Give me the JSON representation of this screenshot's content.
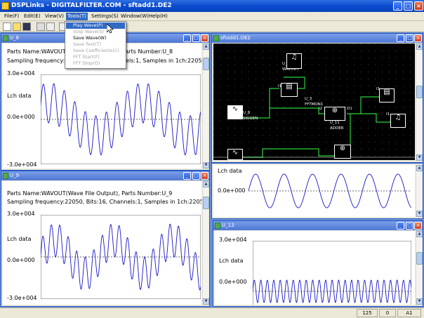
{
  "app": {
    "title": "DSPLinks - DIGITALFILTER.COM - sftadd1.DE2",
    "min": "_",
    "max": "□",
    "close": "×"
  },
  "menu": [
    "File(F)",
    "Edit(E)",
    "View(V)",
    "Tools(T)",
    "Settings(S)",
    "Window(W)",
    "Help(H)"
  ],
  "tools_menu": [
    {
      "label": "Play Wave(P)",
      "state": "highlight"
    },
    {
      "label": "Stop Wave(S)",
      "state": "disabled"
    },
    {
      "label": "Save Wave(W)",
      "state": "enabled"
    },
    {
      "label": "Save Text(T)",
      "state": "disabled"
    },
    {
      "label": "Save Coefficients(C)",
      "state": "disabled"
    },
    {
      "label": "FFT Start(F)",
      "state": "disabled"
    },
    {
      "label": "FFT Stop(O)",
      "state": "disabled"
    }
  ],
  "win_u8": {
    "title": "U_8",
    "line1": "Parts Name:WAVOUT",
    "line1b": "Parts Number:U_8",
    "line2": "Sampling frequency:",
    "line2b": "nels:1, Samples in 1ch:2205",
    "ymax": "3.0e+004",
    "ymid": "0.0e+000",
    "ymin": "-3.0e+004",
    "ylabel": "Lch data"
  },
  "win_u9": {
    "title": "U_9",
    "line1": "Parts Name:WAVOUT(Wave File Output), Parts Number:U_9",
    "line2": "Sampling frequency:22050, Bits:16, Channels:1, Samples in 1ch:2205",
    "ymax": "3.0e+004",
    "ymid": "0.0e+000",
    "ymin": "-3.0e+004",
    "ylabel": "Lch data"
  },
  "win_schem": {
    "title": "sftadd1.DE2",
    "blocks": [
      {
        "id": "b-wavout1",
        "top": "U_12",
        "name": "WAVOUT",
        "glyph": "♫"
      },
      {
        "id": "b-fftmon",
        "top": "U_3",
        "name": "FFTMON1",
        "glyph": "▤"
      },
      {
        "id": "b-sigg1",
        "top": "",
        "name": "SIGGEN",
        "glyph": "∿"
      },
      {
        "id": "b-adder1",
        "top": "U_11",
        "name": "ADDER",
        "glyph": "⊕"
      },
      {
        "id": "b-adder2",
        "top": "",
        "name": "ADDER",
        "glyph": "⊕"
      },
      {
        "id": "b-wavout2",
        "top": "",
        "name": "WAVOUT",
        "glyph": "♫"
      }
    ],
    "labels": [
      "U_12",
      "WAVOUT",
      "U_3",
      "FFTMON1",
      "U_8",
      "SIGGEN",
      "U_11",
      "ADDER",
      "I1",
      "I2",
      "O1",
      "I1",
      "I1"
    ]
  },
  "win_wave2": {
    "ylabel": "Lch data",
    "ymid": "0.0e+000"
  },
  "win_u13": {
    "title": "U_13",
    "ymax": "3.0e+004",
    "ymid": "0.0e+000",
    "ylabel": "Lch data"
  },
  "status": [
    "125",
    "0",
    "A1"
  ]
}
